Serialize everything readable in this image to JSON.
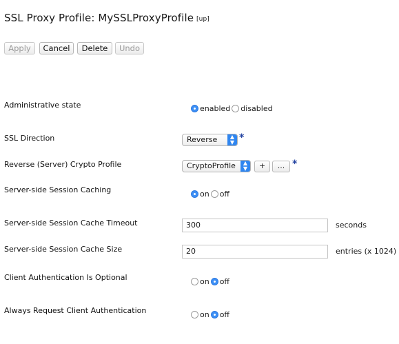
{
  "header": {
    "title": "SSL Proxy Profile: MySSLProxyProfile",
    "up_link": "[up]"
  },
  "toolbar": {
    "apply_label": "Apply",
    "cancel_label": "Cancel",
    "delete_label": "Delete",
    "undo_label": "Undo"
  },
  "form": {
    "admin_state": {
      "label": "Administrative state",
      "options": [
        "enabled",
        "disabled"
      ],
      "selected": "enabled"
    },
    "ssl_direction": {
      "label": "SSL Direction",
      "value": "Reverse",
      "required_mark": "*"
    },
    "reverse_crypto_profile": {
      "label": "Reverse (Server) Crypto Profile",
      "value": "CryptoProfile",
      "add_label": "+",
      "more_label": "...",
      "required_mark": "*"
    },
    "session_caching": {
      "label": "Server-side Session Caching",
      "options": [
        "on",
        "off"
      ],
      "selected": "on"
    },
    "cache_timeout": {
      "label": "Server-side Session Cache Timeout",
      "value": "300",
      "unit": "seconds"
    },
    "cache_size": {
      "label": "Server-side Session Cache Size",
      "value": "20",
      "unit": "entries (x 1024)"
    },
    "client_auth_optional": {
      "label": "Client Authentication Is Optional",
      "options": [
        "on",
        "off"
      ],
      "selected": "off"
    },
    "always_request_client_auth": {
      "label": "Always Request Client Authentication",
      "options": [
        "on",
        "off"
      ],
      "selected": "off"
    }
  },
  "colors": {
    "accent": "#3c8ff5",
    "required": "#1f3f9f"
  }
}
